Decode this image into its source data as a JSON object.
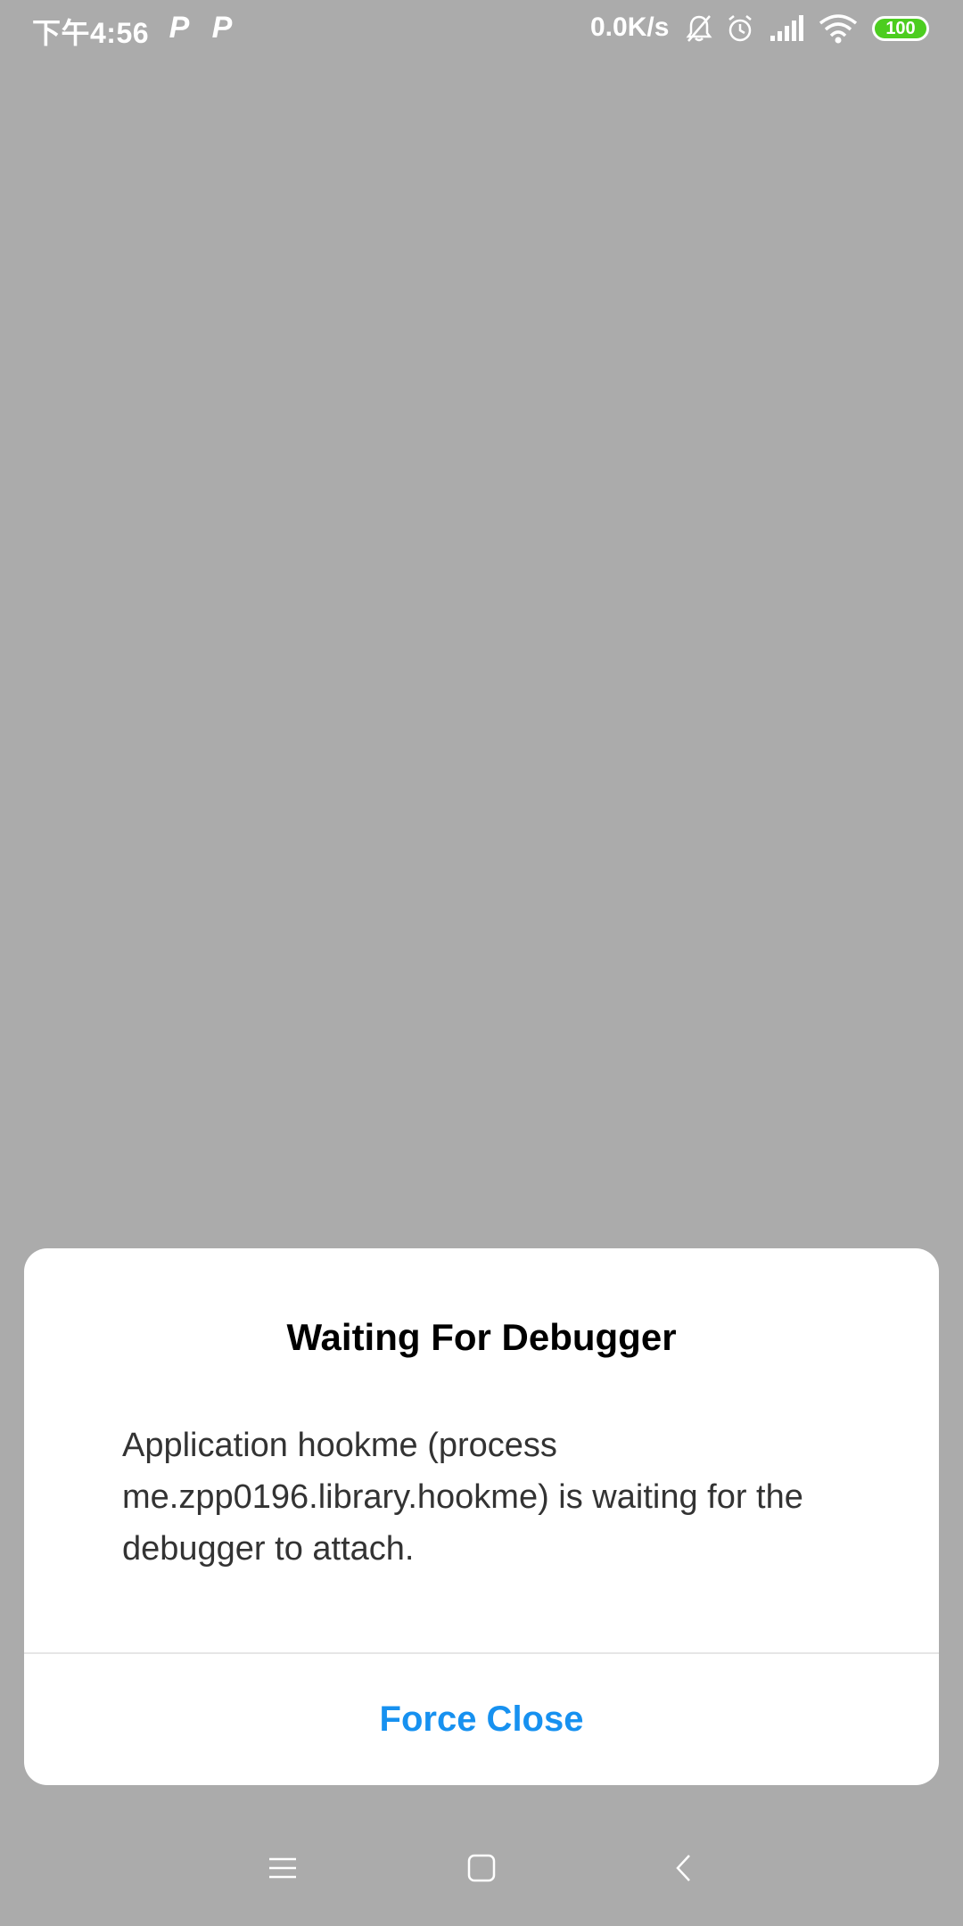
{
  "status_bar": {
    "time": "下午4:56",
    "notification_icons": [
      "P",
      "P"
    ],
    "network_speed": "0.0K/s",
    "battery_level": "100",
    "icons": [
      "bell-muted-icon",
      "alarm-icon",
      "signal-icon",
      "wifi-icon",
      "battery-icon"
    ]
  },
  "dialog": {
    "title": "Waiting For Debugger",
    "message": "Application hookme (process me.zpp0196.library.hookme) is waiting for the debugger to attach.",
    "button_label": "Force Close"
  },
  "nav_bar": {
    "icons": [
      "menu-icon",
      "home-icon",
      "back-icon"
    ]
  },
  "colors": {
    "background": "#ababab",
    "accent": "#1791f0",
    "battery": "#4ccd1f"
  }
}
